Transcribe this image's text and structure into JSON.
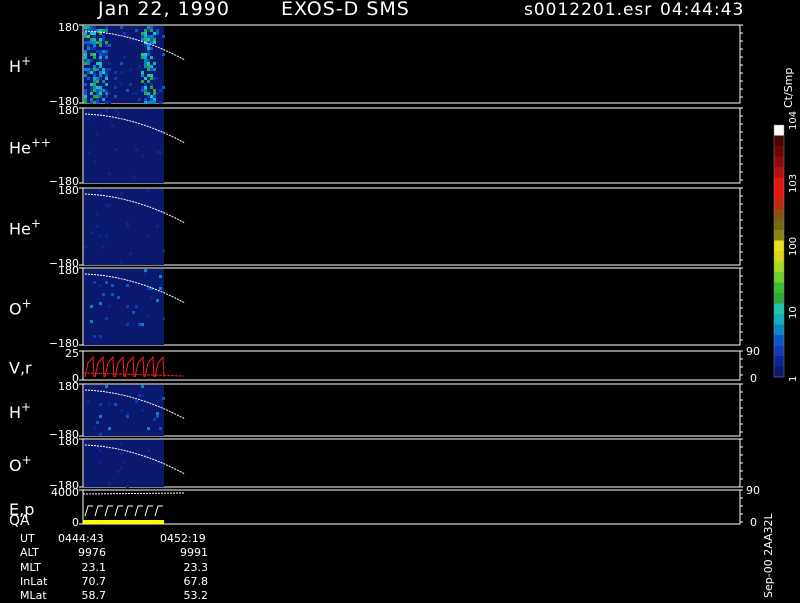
{
  "header": {
    "date": "Jan 22, 1990",
    "instrument": "EXOS-D SMS",
    "file": "s0012201.esr",
    "time": "04:44:43"
  },
  "footer": {
    "rows": [
      {
        "label": "UT",
        "v1": "0444:43",
        "v2": "0452:19"
      },
      {
        "label": "ALT",
        "v1": "9976",
        "v2": "9991"
      },
      {
        "label": "MLT",
        "v1": "23.1",
        "v2": "23.3"
      },
      {
        "label": "InLat",
        "v1": "70.7",
        "v2": "67.8"
      },
      {
        "label": "MLat",
        "v1": "58.7",
        "v2": "53.2"
      }
    ]
  },
  "side_label": "Sep-00  2AA32L",
  "colorbar": {
    "title": "Ct/Smp",
    "tick_labels": [
      {
        "text": "1",
        "value": 1
      },
      {
        "text": "10",
        "value": 10
      },
      {
        "text": "100",
        "value": 100
      },
      {
        "text": "10^3",
        "value": 1000
      },
      {
        "text": "10^4",
        "value": 10000
      }
    ],
    "colors": [
      "#0b1a6e",
      "#0e2694",
      "#103bb5",
      "#0b58c8",
      "#0b86c4",
      "#10b0c0",
      "#19c6b0",
      "#2fa83a",
      "#3fbc2d",
      "#6fd028",
      "#a8d81f",
      "#d8d41a",
      "#e8e21c",
      "#8c8212",
      "#6f6a10",
      "#8d4e0e",
      "#bf2a0d",
      "#e2170d",
      "#e2170d",
      "#b5100c",
      "#8b0b0b",
      "#6a0707",
      "#4a0303",
      "#ffffff"
    ],
    "range": [
      1,
      10000
    ],
    "scale": "log"
  },
  "chart_data": {
    "type": "heatmap",
    "panels": [
      {
        "label": "H",
        "superscript": "+",
        "kind": "angle",
        "ymax": "180",
        "ymin": "−180",
        "yrange": [
          -180,
          180
        ],
        "hot_columns": [
          "0444:43-0446:10",
          "0450:05-0450:50"
        ],
        "mean_level": 10,
        "peak_level": 300
      },
      {
        "label": "He",
        "superscript": "++",
        "kind": "angle",
        "ymax": "180",
        "ymin": "−180",
        "yrange": [
          -180,
          180
        ],
        "mean_level": 1
      },
      {
        "label": "He",
        "superscript": "+",
        "kind": "angle",
        "ymax": "180",
        "ymin": "−180",
        "yrange": [
          -180,
          180
        ],
        "mean_level": 1
      },
      {
        "label": "O",
        "superscript": "+",
        "kind": "angle",
        "ymax": "180",
        "ymin": "−180",
        "yrange": [
          -180,
          180
        ],
        "mean_level": 1,
        "peak_level": 10
      },
      {
        "label": "V,r",
        "superscript": "",
        "kind": "line",
        "ymax": "25",
        "ymin": "0",
        "yrange": [
          0,
          25
        ],
        "right_ticks": [
          "90",
          "0"
        ],
        "line_color": "#ff2020"
      },
      {
        "label": "H",
        "superscript": "+",
        "kind": "angle",
        "ymax": "180",
        "ymin": "−180",
        "yrange": [
          -180,
          180
        ],
        "mean_level": 1,
        "peak_level": 10
      },
      {
        "label": "O",
        "superscript": "+",
        "kind": "angle",
        "ymax": "180",
        "ymin": "−180",
        "yrange": [
          -180,
          180
        ],
        "mean_level": 1
      },
      {
        "label": "E,p",
        "superscript": "",
        "kind": "line",
        "ymax": "4000",
        "ymin": "0",
        "yrange": [
          0,
          4000
        ],
        "right_ticks": [
          "90",
          "0"
        ],
        "line_color": "#ffffff",
        "extra_label": "QA",
        "qa_color": "#ffff00"
      }
    ],
    "x_range": [
      "0444:43",
      "0452:19"
    ],
    "data_coverage_fraction": 0.12
  }
}
